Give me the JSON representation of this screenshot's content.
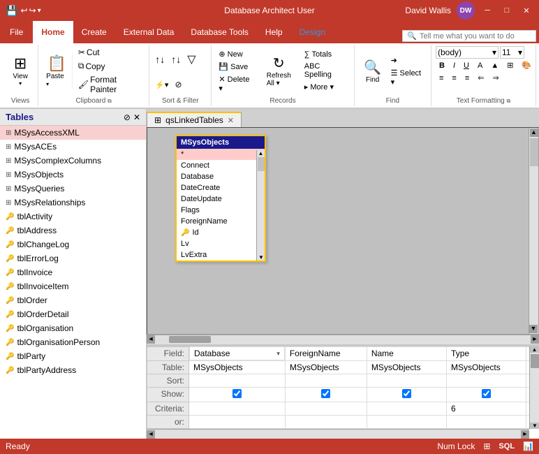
{
  "titleBar": {
    "title": "Database Architect User",
    "userName": "David Wallis",
    "userInitials": "DW",
    "saveIcon": "💾",
    "undoIcon": "↩",
    "redoIcon": "↪"
  },
  "ribbon": {
    "tabs": [
      "File",
      "Home",
      "Create",
      "External Data",
      "Database Tools",
      "Help",
      "Design"
    ],
    "activeTab": "Home",
    "groups": {
      "views": {
        "label": "Views",
        "buttons": [
          {
            "label": "View",
            "icon": "⊞"
          }
        ]
      },
      "clipboard": {
        "label": "Clipboard",
        "buttons": [
          {
            "label": "Paste",
            "icon": "📋"
          },
          {
            "label": "Cut",
            "icon": "✂"
          },
          {
            "label": "Copy",
            "icon": "⧉"
          },
          {
            "label": "Format",
            "icon": "🖌"
          }
        ]
      },
      "sortFilter": {
        "label": "Sort & Filter",
        "buttons": [
          "↑↓",
          "↑",
          "↓",
          "▼",
          "⚡",
          "∅"
        ]
      },
      "records": {
        "label": "Records",
        "refresh": "Refresh",
        "buttons": [
          "⊕",
          "💾",
          "✕",
          "∑",
          "ABC",
          "↺"
        ]
      },
      "find": {
        "label": "Find",
        "buttons": [
          {
            "label": "Find",
            "icon": "🔍"
          }
        ]
      },
      "textFormatting": {
        "label": "Text Formatting"
      }
    },
    "searchPlaceholder": "Tell me what you want to do"
  },
  "tablesPanel": {
    "title": "Tables",
    "items": [
      {
        "name": "MSysAccessXML",
        "highlighted": true,
        "key": false
      },
      {
        "name": "MSysACEs",
        "highlighted": false,
        "key": false
      },
      {
        "name": "MSysComplexColumns",
        "highlighted": false,
        "key": false
      },
      {
        "name": "MSysObjects",
        "highlighted": false,
        "key": false
      },
      {
        "name": "MSysQueries",
        "highlighted": false,
        "key": false
      },
      {
        "name": "MSysRelationships",
        "highlighted": false,
        "key": false
      },
      {
        "name": "tblActivity",
        "highlighted": false,
        "key": true
      },
      {
        "name": "tblAddress",
        "highlighted": false,
        "key": true
      },
      {
        "name": "tblChangeLog",
        "highlighted": false,
        "key": true
      },
      {
        "name": "tblErrorLog",
        "highlighted": false,
        "key": true
      },
      {
        "name": "tblInvoice",
        "highlighted": false,
        "key": true
      },
      {
        "name": "tblInvoiceItem",
        "highlighted": false,
        "key": true
      },
      {
        "name": "tblOrder",
        "highlighted": false,
        "key": true
      },
      {
        "name": "tblOrderDetail",
        "highlighted": false,
        "key": true
      },
      {
        "name": "tblOrganisation",
        "highlighted": false,
        "key": true
      },
      {
        "name": "tblOrganisationPerson",
        "highlighted": false,
        "key": true
      },
      {
        "name": "tblParty",
        "highlighted": false,
        "key": true
      },
      {
        "name": "tblPartyAddress",
        "highlighted": false,
        "key": true
      }
    ]
  },
  "queryDesigner": {
    "tabName": "qsLinkedTables",
    "tableBox": {
      "name": "MSysObjects",
      "fields": [
        "*",
        "Connect",
        "Database",
        "DateCreate",
        "DateUpdate",
        "Flags",
        "ForeignName",
        "Id",
        "Lv",
        "LvExtra"
      ]
    },
    "grid": {
      "rowHeaders": [
        "Field:",
        "Table:",
        "Sort:",
        "Show:",
        "Criteria:",
        "or:"
      ],
      "columns": [
        {
          "field": "Database",
          "table": "MSysObjects",
          "sort": "",
          "show": true,
          "criteria": "",
          "or": ""
        },
        {
          "field": "ForeignName",
          "table": "MSysObjects",
          "sort": "",
          "show": true,
          "criteria": "",
          "or": ""
        },
        {
          "field": "Name",
          "table": "MSysObjects",
          "sort": "",
          "show": true,
          "criteria": "",
          "or": ""
        },
        {
          "field": "Type",
          "table": "MSysObjects",
          "sort": "",
          "show": true,
          "criteria": "6",
          "or": ""
        }
      ]
    }
  },
  "statusBar": {
    "ready": "Ready",
    "numLock": "Num Lock",
    "icons": [
      "⊞",
      "SQL",
      "📊"
    ]
  }
}
